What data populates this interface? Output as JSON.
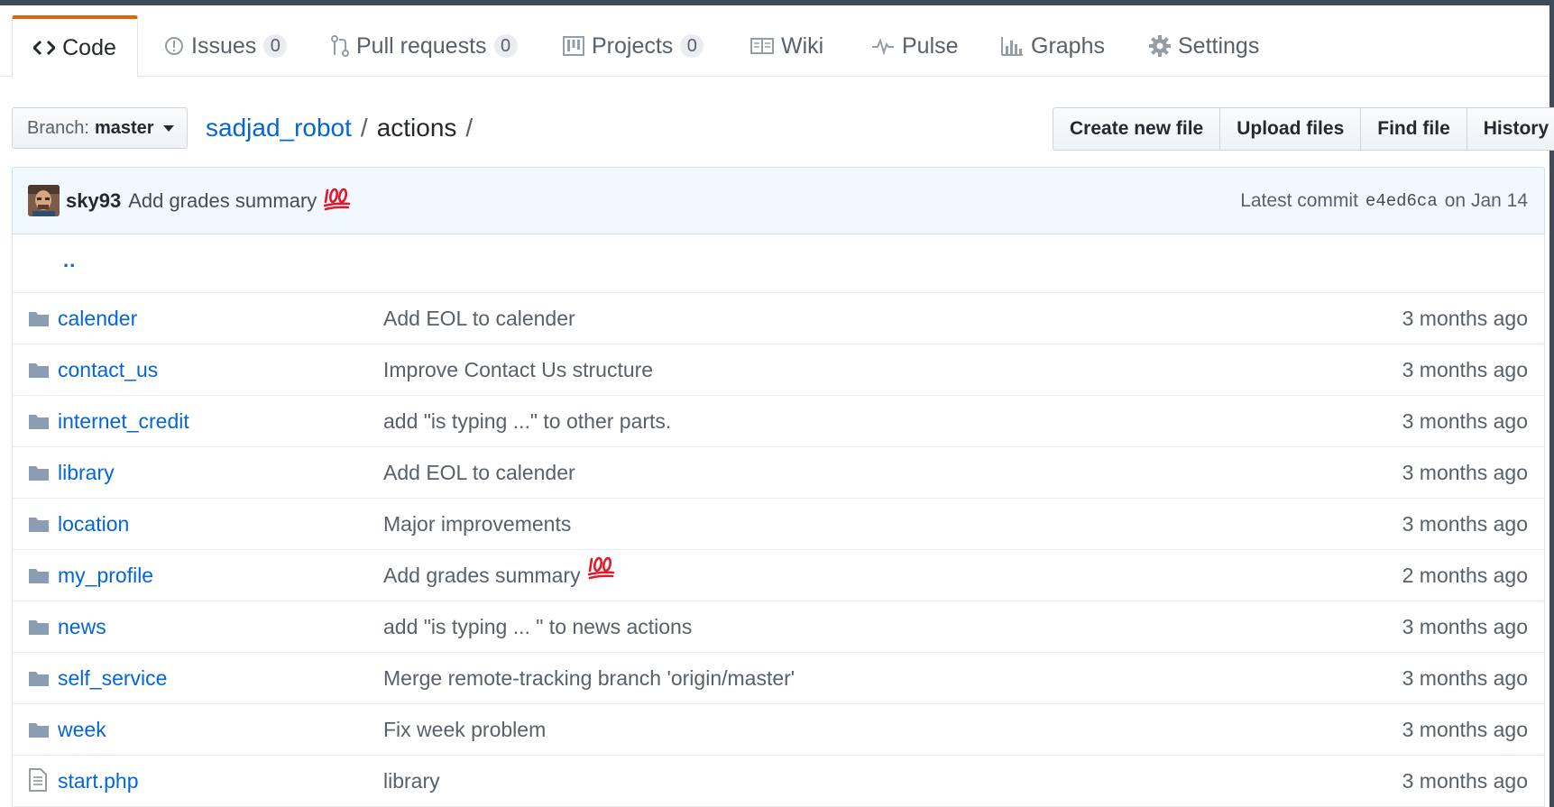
{
  "tabs": [
    {
      "label": "Code",
      "icon": "code-icon"
    },
    {
      "label": "Issues",
      "count": "0",
      "icon": "issue-opened-icon"
    },
    {
      "label": "Pull requests",
      "count": "0",
      "icon": "git-pull-request-icon"
    },
    {
      "label": "Projects",
      "count": "0",
      "icon": "project-icon"
    },
    {
      "label": "Wiki",
      "icon": "book-icon"
    },
    {
      "label": "Pulse",
      "icon": "pulse-icon"
    },
    {
      "label": "Graphs",
      "icon": "graph-icon"
    },
    {
      "label": "Settings",
      "icon": "gear-icon"
    }
  ],
  "branch": {
    "prefix": "Branch:",
    "name": "master"
  },
  "breadcrumb": {
    "repo": "sadjad_robot",
    "sep": "/",
    "folder": "actions",
    "trail": "/"
  },
  "actions": {
    "create_new_file": "Create new file",
    "upload_files": "Upload files",
    "find_file": "Find file",
    "history": "History"
  },
  "latest_commit": {
    "author": "sky93",
    "message": "Add grades summary",
    "emoji": "100-emoji",
    "label": "Latest commit",
    "sha": "e4ed6ca",
    "date": "on Jan 14"
  },
  "parent_link": "..",
  "colors": {
    "link": "#0366d6",
    "tab_accent": "#e36209",
    "commit_bg": "#f1f8ff",
    "folder_icon": "#79b8ff"
  },
  "files": [
    {
      "name": "calender",
      "type": "folder",
      "message": "Add EOL to calender",
      "age": "3 months ago"
    },
    {
      "name": "contact_us",
      "type": "folder",
      "message": "Improve Contact Us structure",
      "age": "3 months ago"
    },
    {
      "name": "internet_credit",
      "type": "folder",
      "message": "add \"is typing ...\" to other parts.",
      "age": "3 months ago"
    },
    {
      "name": "library",
      "type": "folder",
      "message": "Add EOL to calender",
      "age": "3 months ago"
    },
    {
      "name": "location",
      "type": "folder",
      "message": "Major improvements",
      "age": "3 months ago"
    },
    {
      "name": "my_profile",
      "type": "folder",
      "message": "Add grades summary",
      "emoji": "100-emoji",
      "age": "2 months ago"
    },
    {
      "name": "news",
      "type": "folder",
      "message": "add \"is typing ... \" to news actions",
      "age": "3 months ago"
    },
    {
      "name": "self_service",
      "type": "folder",
      "message": "Merge remote-tracking branch 'origin/master'",
      "age": "3 months ago"
    },
    {
      "name": "week",
      "type": "folder",
      "message": "Fix week problem",
      "age": "3 months ago"
    },
    {
      "name": "start.php",
      "type": "file",
      "message": "library",
      "age": "3 months ago"
    }
  ]
}
